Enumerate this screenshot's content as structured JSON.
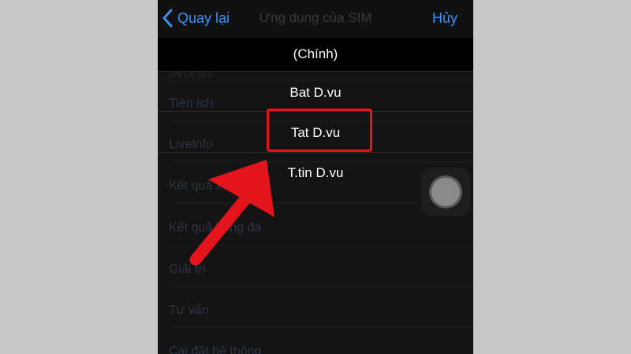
{
  "navbar": {
    "back_label": "Quay lại",
    "title": "Ứng dụng của SIM",
    "cancel_label": "Hủy"
  },
  "background_list": [
    {
      "label": "Sốt LK Sim",
      "small": true
    },
    {
      "label": "Tiện ích"
    },
    {
      "label": "LiveInfo"
    },
    {
      "label": "Kết quả xổ số"
    },
    {
      "label": "Kết quả bóng đá"
    },
    {
      "label": "Giải trí"
    },
    {
      "label": "Tư vấn"
    },
    {
      "label": "Cài đặt hệ thống"
    }
  ],
  "picker": {
    "header": "(Chính)",
    "options": [
      "Bat D.vu",
      "Tat D.vu",
      "T.tin D.vu"
    ],
    "highlighted_option": "Tat D.vu"
  },
  "colors": {
    "accent": "#3c8ef5",
    "highlight": "#e3141c",
    "arrow": "#e3141c"
  }
}
